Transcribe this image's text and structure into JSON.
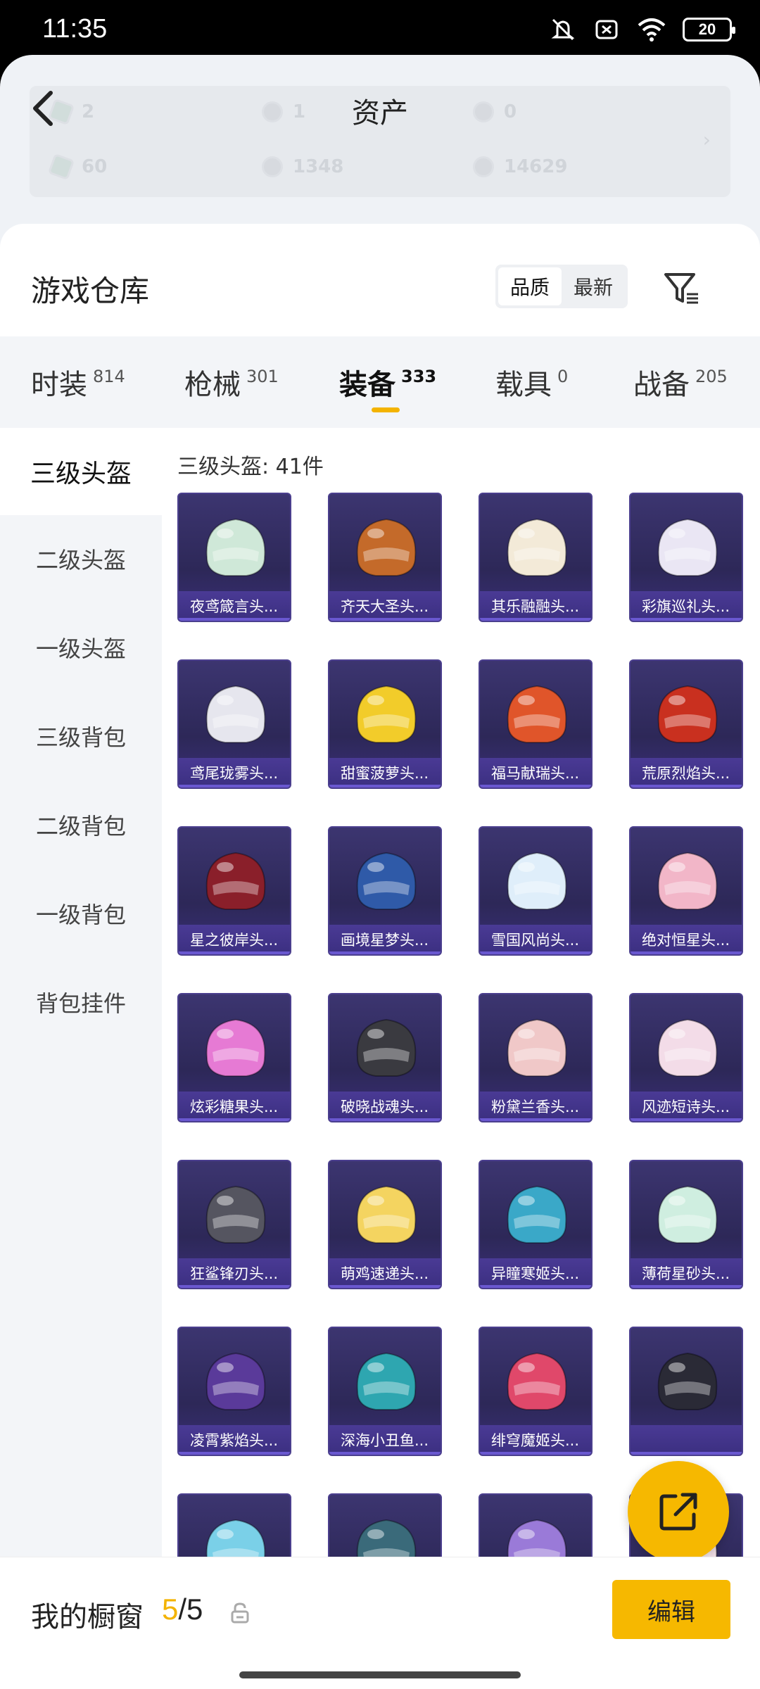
{
  "status_bar": {
    "time": "11:35",
    "battery": "20"
  },
  "header": {
    "title": "资产"
  },
  "assets": {
    "row1": [
      "2",
      "1",
      "0"
    ],
    "row2": [
      "60",
      "1348",
      "14629"
    ]
  },
  "warehouse": {
    "title": "游戏仓库",
    "sort_quality": "品质",
    "sort_newest": "最新"
  },
  "tabs": [
    {
      "label": "时装",
      "count": "814"
    },
    {
      "label": "枪械",
      "count": "301"
    },
    {
      "label": "装备",
      "count": "333"
    },
    {
      "label": "载具",
      "count": "0"
    },
    {
      "label": "战备",
      "count": "205"
    }
  ],
  "side_menu": [
    "三级头盔",
    "二级头盔",
    "一级头盔",
    "三级背包",
    "二级背包",
    "一级背包",
    "背包挂件"
  ],
  "category_count": "三级头盔: 41件",
  "items": [
    {
      "name": "夜鸢箴言头...",
      "color": "#cfe8d8"
    },
    {
      "name": "齐天大圣头...",
      "color": "#c46a2a"
    },
    {
      "name": "其乐融融头...",
      "color": "#f3ead8"
    },
    {
      "name": "彩旗巡礼头...",
      "color": "#eae6f4"
    },
    {
      "name": "鸢尾珑雾头...",
      "color": "#e6e6ee"
    },
    {
      "name": "甜蜜菠萝头...",
      "color": "#f2cc2a"
    },
    {
      "name": "福马献瑞头...",
      "color": "#e0552a"
    },
    {
      "name": "荒原烈焰头...",
      "color": "#c9301f"
    },
    {
      "name": "星之彼岸头...",
      "color": "#8a1f2a"
    },
    {
      "name": "画境星梦头...",
      "color": "#2f5aa8"
    },
    {
      "name": "雪国风尚头...",
      "color": "#dfeefa"
    },
    {
      "name": "绝对恒星头...",
      "color": "#f2b6c8"
    },
    {
      "name": "炫彩糖果头...",
      "color": "#e67ad4"
    },
    {
      "name": "破晓战魂头...",
      "color": "#3a3a40"
    },
    {
      "name": "粉黛兰香头...",
      "color": "#f0c8c8"
    },
    {
      "name": "风迹短诗头...",
      "color": "#f3dce8"
    },
    {
      "name": "狂鲨锋刃头...",
      "color": "#555560"
    },
    {
      "name": "萌鸡速递头...",
      "color": "#f4d460"
    },
    {
      "name": "异瞳寒姬头...",
      "color": "#3aa8c8"
    },
    {
      "name": "薄荷星砂头...",
      "color": "#cfeee0"
    },
    {
      "name": "凌霄紫焰头...",
      "color": "#5a3a9a"
    },
    {
      "name": "深海小丑鱼...",
      "color": "#2ea6b0"
    },
    {
      "name": "绯穹魔姬头...",
      "color": "#e0486a"
    },
    {
      "name": "",
      "color": "#2a2a36"
    },
    {
      "name": "",
      "color": "#7ad0e8"
    },
    {
      "name": "",
      "color": "#3a6a7a"
    },
    {
      "name": "",
      "color": "#9a7ad8"
    },
    {
      "name": "",
      "color": "#f3e0e8"
    }
  ],
  "bottom": {
    "label": "我的橱窗",
    "count_highlight": "5",
    "count_rest": "/5",
    "edit": "编辑"
  }
}
